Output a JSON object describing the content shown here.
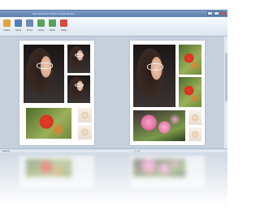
{
  "window": {
    "title": "Wondershare Photo Collage Studio",
    "controls": [
      "minimize",
      "maximize",
      "close"
    ]
  },
  "toolbar": {
    "tools": [
      {
        "label": "Open",
        "icon": "folder-icon",
        "color": "#e2a33c"
      },
      {
        "label": "Save",
        "icon": "save-icon",
        "color": "#4f7fbf"
      },
      {
        "label": "Print",
        "icon": "print-icon",
        "color": "#6d8caf"
      },
      {
        "label": "Undo",
        "icon": "undo-icon",
        "color": "#5aa05a"
      },
      {
        "label": "Redo",
        "icon": "redo-icon",
        "color": "#5aa05a"
      },
      {
        "label": "Help",
        "icon": "help-icon",
        "color": "#d94b3d"
      }
    ]
  },
  "pages": [
    {
      "name": "page-1",
      "photos": [
        "woman-portrait",
        "woman-portrait",
        "woman-portrait",
        "red-flower",
        "cake",
        "cake"
      ]
    },
    {
      "name": "page-2",
      "photos": [
        "woman-portrait",
        "red-flower",
        "red-flower",
        "pink-flower",
        "cake",
        "cake"
      ]
    }
  ],
  "statusbar": {
    "left_text": "Ready",
    "middle_text": "1 / 2"
  }
}
